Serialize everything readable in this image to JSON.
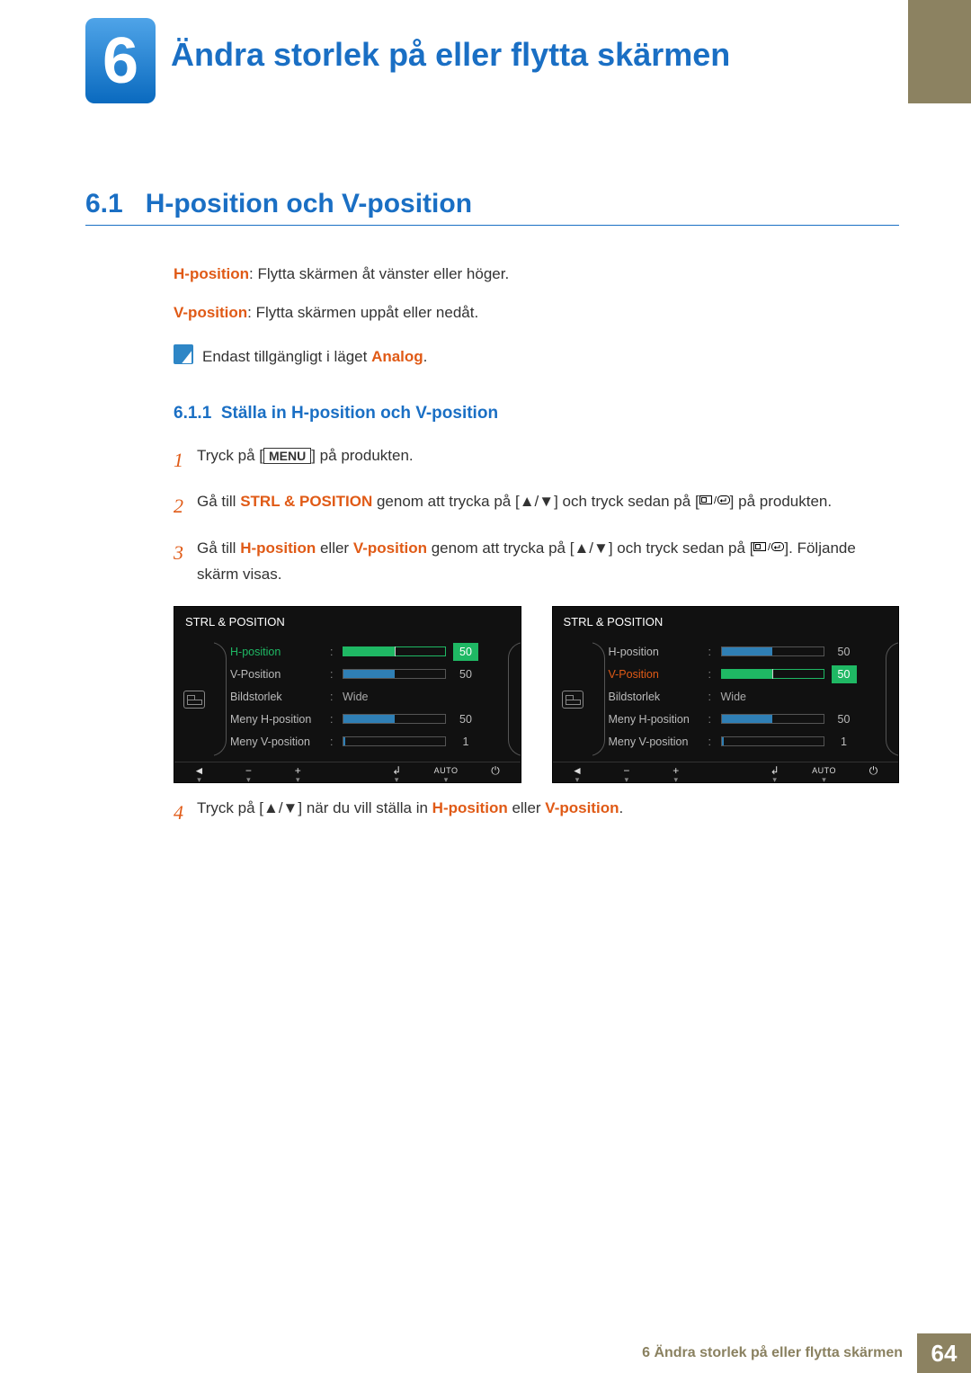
{
  "chapter": {
    "number": "6",
    "title": "Ändra storlek på eller flytta skärmen"
  },
  "section": {
    "number": "6.1",
    "title": "H-position och V-position"
  },
  "desc": {
    "h_term": "H-position",
    "h_text": ": Flytta skärmen åt vänster eller höger.",
    "v_term": "V-position",
    "v_text": ": Flytta skärmen uppåt eller nedåt.",
    "note_pre": "Endast tillgängligt i läget ",
    "note_mode": "Analog",
    "note_post": "."
  },
  "subsection": {
    "number": "6.1.1",
    "title": "Ställa in H-position och V-position"
  },
  "steps": {
    "s1": {
      "num": "1",
      "a": "Tryck på [",
      "menu": "MENU",
      "b": "] på produkten."
    },
    "s2": {
      "num": "2",
      "a": "Gå till ",
      "link": "STRL & POSITION",
      "b": " genom att trycka på [",
      "c": "] och tryck sedan på [",
      "d": "] på produkten."
    },
    "s3": {
      "num": "3",
      "a": "Gå till ",
      "h": "H-position",
      "mid": " eller ",
      "v": "V-position",
      "b": " genom att trycka på [",
      "c": "] och tryck sedan på [",
      "d": "]. Följande skärm visas."
    },
    "s4": {
      "num": "4",
      "a": "Tryck på [",
      "b": "] när du vill ställa in ",
      "h": "H-position",
      "mid": " eller ",
      "v": "V-position",
      "end": "."
    }
  },
  "osd": {
    "title": "STRL & POSITION",
    "rows": {
      "h": "H-position",
      "v": "V-Position",
      "size": "Bildstorlek",
      "size_val": "Wide",
      "mh": "Meny H-position",
      "mv": "Meny V-position"
    },
    "values": {
      "h": "50",
      "v": "50",
      "mh": "50",
      "mv": "1"
    },
    "footer": {
      "back": "◄",
      "minus": "−",
      "plus": "+",
      "enter": "↲",
      "auto": "AUTO",
      "power": "⏻"
    }
  },
  "chart_data": [
    {
      "type": "table",
      "title": "STRL & POSITION (vänster, H-position vald)",
      "rows": [
        {
          "label": "H-position",
          "value": 50,
          "selected": true
        },
        {
          "label": "V-Position",
          "value": 50
        },
        {
          "label": "Bildstorlek",
          "value": "Wide"
        },
        {
          "label": "Meny H-position",
          "value": 50
        },
        {
          "label": "Meny V-position",
          "value": 1
        }
      ]
    },
    {
      "type": "table",
      "title": "STRL & POSITION (höger, V-Position vald)",
      "rows": [
        {
          "label": "H-position",
          "value": 50
        },
        {
          "label": "V-Position",
          "value": 50,
          "selected": true
        },
        {
          "label": "Bildstorlek",
          "value": "Wide"
        },
        {
          "label": "Meny H-position",
          "value": 50
        },
        {
          "label": "Meny V-position",
          "value": 1
        }
      ]
    }
  ],
  "footer": {
    "text": "6 Ändra storlek på eller flytta skärmen",
    "page": "64"
  }
}
